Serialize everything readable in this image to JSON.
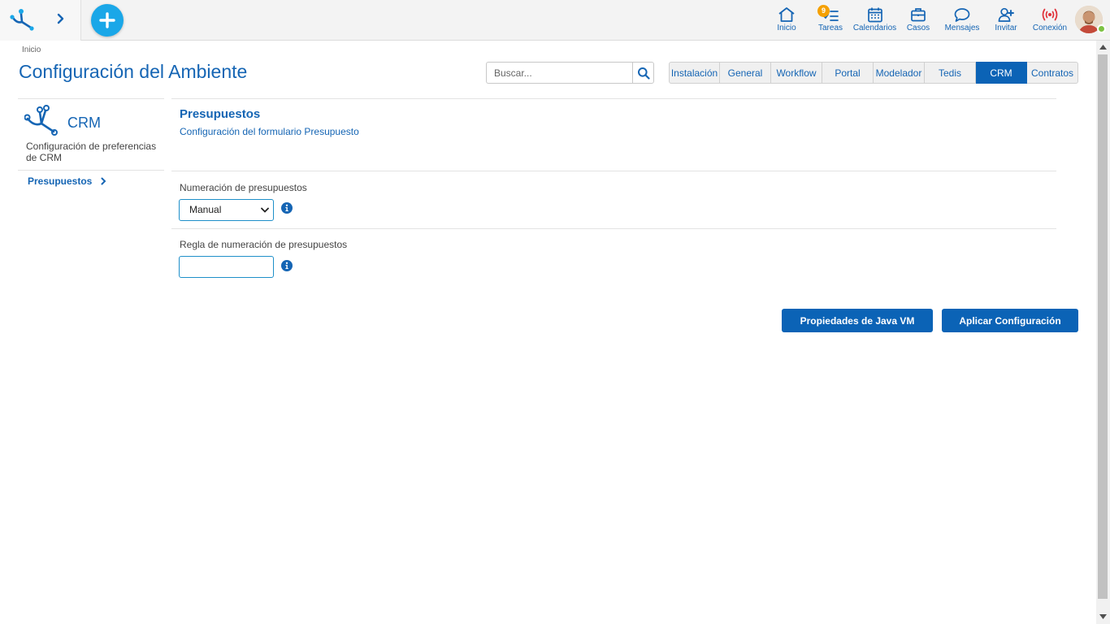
{
  "colors": {
    "primary": "#1565b4",
    "accent": "#1aa7e8",
    "active_tab": "#0b63b6",
    "badge": "#f5a000",
    "online": "#7cc243",
    "connection": "#e0323a"
  },
  "topbar": {
    "nav": [
      {
        "id": "inicio",
        "label": "Inicio",
        "icon": "home-icon"
      },
      {
        "id": "tareas",
        "label": "Tareas",
        "icon": "tasks-icon",
        "badge": "9"
      },
      {
        "id": "calendarios",
        "label": "Calendarios",
        "icon": "calendar-icon"
      },
      {
        "id": "casos",
        "label": "Casos",
        "icon": "briefcase-icon"
      },
      {
        "id": "mensajes",
        "label": "Mensajes",
        "icon": "chat-icon"
      },
      {
        "id": "invitar",
        "label": "Invitar",
        "icon": "add-user-icon"
      },
      {
        "id": "conexion",
        "label": "Conexión",
        "icon": "broadcast-icon"
      }
    ]
  },
  "header": {
    "breadcrumb": "Inicio",
    "title": "Configuración del Ambiente",
    "search_placeholder": "Buscar..."
  },
  "tabs": [
    {
      "label": "Instalación",
      "active": false
    },
    {
      "label": "General",
      "active": false
    },
    {
      "label": "Workflow",
      "active": false
    },
    {
      "label": "Portal",
      "active": false
    },
    {
      "label": "Modelador",
      "active": false
    },
    {
      "label": "Tedis",
      "active": false
    },
    {
      "label": "CRM",
      "active": true
    },
    {
      "label": "Contratos",
      "active": false
    }
  ],
  "sidebar": {
    "title": "CRM",
    "description": "Configuración de preferencias de CRM",
    "items": [
      {
        "label": "Presupuestos"
      }
    ]
  },
  "main": {
    "section_title": "Presupuestos",
    "section_subtitle": "Configuración del formulario Presupuesto",
    "fields": {
      "numeracion": {
        "label": "Numeración de presupuestos",
        "value": "Manual"
      },
      "regla": {
        "label": "Regla de numeración de presupuestos",
        "value": ""
      }
    },
    "buttons": {
      "java_vm": "Propiedades de Java VM",
      "apply": "Aplicar Configuración"
    }
  }
}
